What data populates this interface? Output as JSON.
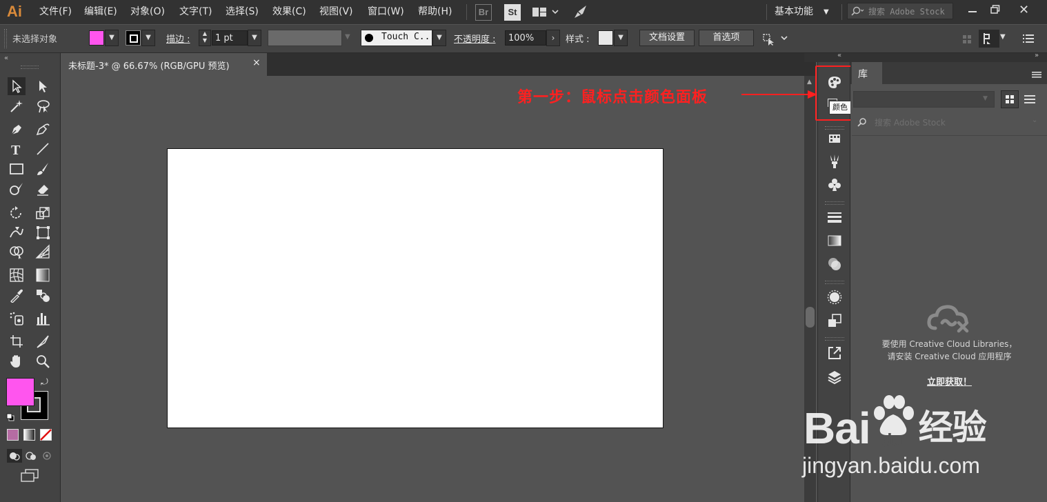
{
  "app": {
    "logo": "Ai"
  },
  "menus": [
    "文件(F)",
    "编辑(E)",
    "对象(O)",
    "文字(T)",
    "选择(S)",
    "效果(C)",
    "视图(V)",
    "窗口(W)",
    "帮助(H)"
  ],
  "bridge_label": "Br",
  "stock_label": "St",
  "workspace": "基本功能",
  "stock_search": {
    "placeholder": "搜索 Adobe Stock"
  },
  "control": {
    "selection_status": "未选择对象",
    "stroke_label": "描边 :",
    "stroke_value": "1 pt",
    "brush_name": "Touch C...",
    "opacity_label": "不透明度 :",
    "opacity_value": "100%",
    "style_label": "样式 :",
    "doc_setup": "文档设置",
    "preferences": "首选项"
  },
  "colors": {
    "fill": "#ff55ee",
    "stroke": "#000000",
    "annotation": "#ff2020"
  },
  "document_tab": {
    "title": "未标题-3* @ 66.67% (RGB/GPU 预览)",
    "close": "×"
  },
  "annotation": {
    "text": "第一步：鼠标点击颜色面板"
  },
  "tooltip": "颜色",
  "library": {
    "tab_title": "库",
    "search_placeholder": "搜索 Adobe Stock",
    "message_line1": "要使用 Creative Cloud Libraries，",
    "message_line2": "请安装 Creative Cloud 应用程序",
    "link": "立即获取！"
  },
  "watermark": {
    "brand": "Bai",
    "brand2": "du",
    "brand_cn": "经验",
    "url": "jingyan.baidu.com"
  }
}
